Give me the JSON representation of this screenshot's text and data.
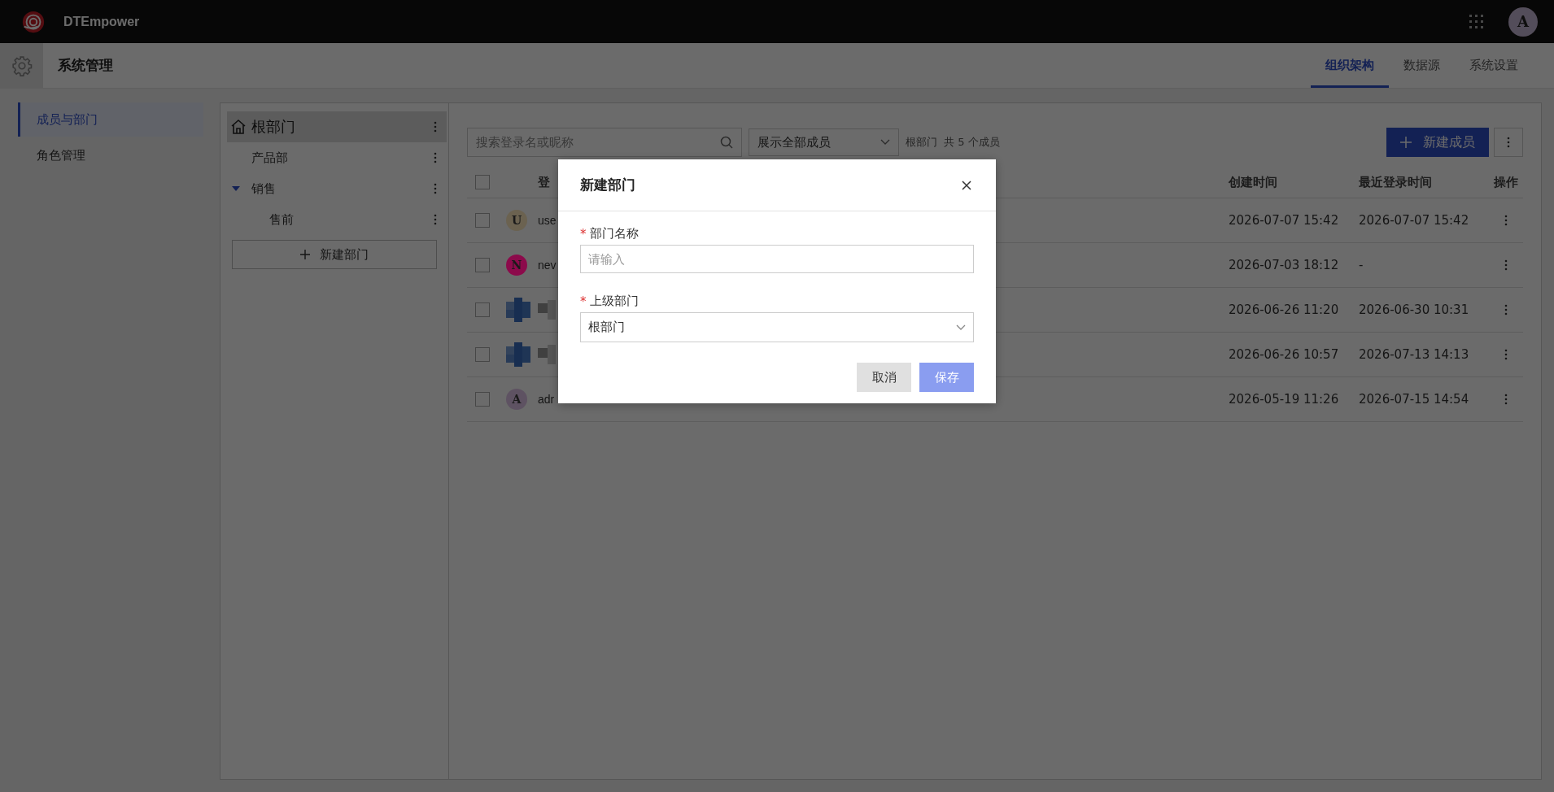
{
  "app": {
    "name": "DTEmpower",
    "avatar_letter": "A"
  },
  "module": {
    "title": "系统管理"
  },
  "tabs": [
    {
      "label": "组织架构",
      "selected": true
    },
    {
      "label": "数据源",
      "selected": false
    },
    {
      "label": "系统设置",
      "selected": false
    }
  ],
  "nav": [
    {
      "label": "成员与部门",
      "selected": true
    },
    {
      "label": "角色管理",
      "selected": false
    }
  ],
  "tree": {
    "root": {
      "label": "根部门",
      "selected": true
    },
    "children": [
      {
        "label": "产品部"
      },
      {
        "label": "销售",
        "expanded": true,
        "children": [
          {
            "label": "售前"
          }
        ]
      }
    ],
    "add_button": "新建部门"
  },
  "toolbar": {
    "search_placeholder": "搜索登录名或昵称",
    "filter_value": "展示全部成员",
    "scope": "根部门",
    "count": "共 5 个成员",
    "new_button": "新建成员"
  },
  "table": {
    "all_checked": false,
    "columns": [
      "登",
      "创建时间",
      "最近登录时间",
      "操作"
    ],
    "rows": [
      {
        "avatar": {
          "kind": "letter",
          "letter": "U",
          "color": "#6b6250"
        },
        "name": "use",
        "created": "2026-07-07 15:42",
        "last_login": "2026-07-07 15:42",
        "checked": false
      },
      {
        "avatar": {
          "kind": "letter",
          "letter": "N",
          "color": "#8c0a4b"
        },
        "name": "nev",
        "created": "2026-07-03 18:12",
        "last_login": "-",
        "checked": false
      },
      {
        "avatar": {
          "kind": "blurred"
        },
        "created": "2026-06-26 11:20",
        "last_login": "2026-06-30 10:31",
        "checked": false
      },
      {
        "avatar": {
          "kind": "blurred"
        },
        "created": "2026-06-26 10:57",
        "last_login": "2026-07-13 14:13",
        "checked": false
      },
      {
        "avatar": {
          "kind": "letter",
          "letter": "A",
          "color": "#5e5262"
        },
        "name": "adr",
        "created": "2026-05-19 11:26",
        "last_login": "2026-07-15 14:54",
        "checked": false
      }
    ]
  },
  "dialog": {
    "title": "新建部门",
    "fields": [
      {
        "kind": "input",
        "label": "部门名称",
        "required_mark": "*",
        "placeholder": "请输入"
      },
      {
        "kind": "select",
        "label": "上级部门",
        "required_mark": "*",
        "value": "根部门"
      }
    ],
    "buttons": [
      {
        "kind": "secondary",
        "label": "取消",
        "disabled": false
      },
      {
        "kind": "primary",
        "label": "保存",
        "disabled": true
      }
    ]
  }
}
